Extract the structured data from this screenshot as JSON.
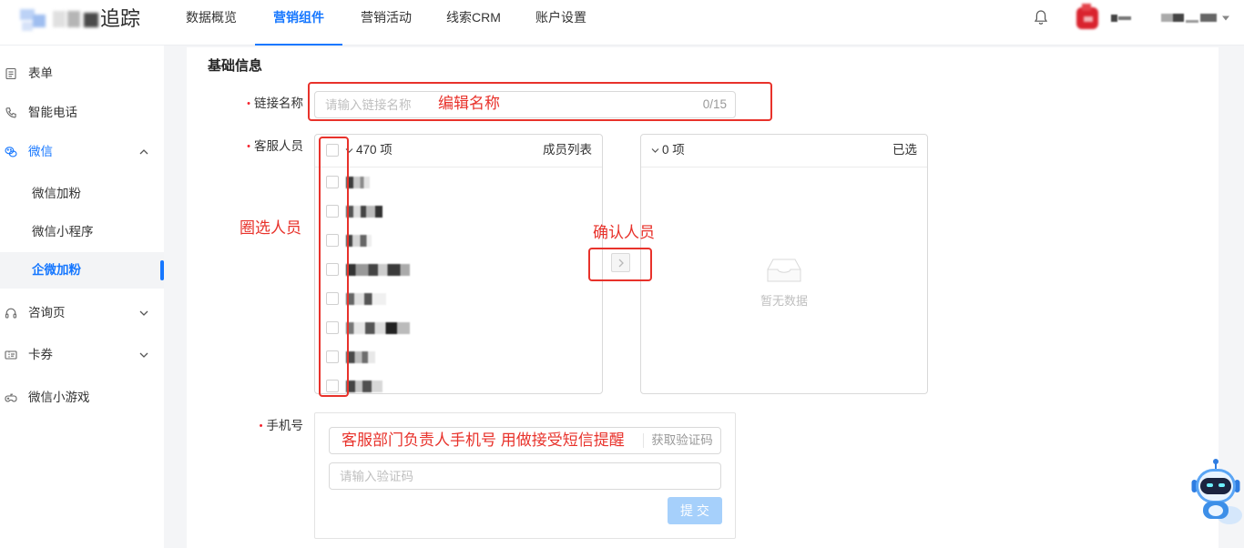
{
  "header": {
    "logo_text": "追踪",
    "nav": [
      {
        "label": "数据概览",
        "active": false
      },
      {
        "label": "营销组件",
        "active": true
      },
      {
        "label": "营销活动",
        "active": false
      },
      {
        "label": "线索CRM",
        "active": false
      },
      {
        "label": "账户设置",
        "active": false
      }
    ],
    "icons": {
      "notification": "bell-icon",
      "user_menu": "caret-down-icon"
    }
  },
  "sidebar": {
    "items": [
      {
        "label": "表单",
        "icon": "form-icon"
      },
      {
        "label": "智能电话",
        "icon": "phone-icon"
      },
      {
        "label": "微信",
        "icon": "wechat-icon",
        "expanded": true,
        "children": [
          {
            "label": "微信加粉",
            "active": false
          },
          {
            "label": "微信小程序",
            "active": false
          },
          {
            "label": "企微加粉",
            "active": true
          }
        ]
      },
      {
        "label": "咨询页",
        "icon": "headset-icon",
        "expanded": false
      },
      {
        "label": "卡券",
        "icon": "coupon-icon",
        "expanded": false
      },
      {
        "label": "微信小游戏",
        "icon": "gamepad-icon"
      }
    ]
  },
  "form": {
    "section_title": "基础信息",
    "required_mark": "•",
    "link_name": {
      "label": "链接名称",
      "placeholder": "请输入链接名称",
      "counter": "0/15"
    },
    "staff": {
      "label": "客服人员",
      "source": {
        "count": "470 项",
        "title": "成员列表",
        "items": [
          {
            "checked": false,
            "name_redacted": true
          },
          {
            "checked": false,
            "name_redacted": true
          },
          {
            "checked": false,
            "name_redacted": true
          },
          {
            "checked": false,
            "name_redacted": true
          },
          {
            "checked": false,
            "name_redacted": true
          },
          {
            "checked": false,
            "name_redacted": true
          },
          {
            "checked": false,
            "name_redacted": true
          },
          {
            "checked": false,
            "name_redacted": true
          }
        ]
      },
      "transfer_icon": "chevron-right-icon",
      "target": {
        "count": "0 项",
        "title": "已选",
        "empty_text": "暂无数据",
        "empty_icon": "inbox-icon"
      }
    },
    "phone": {
      "label": "手机号",
      "get_code_label": "获取验证码",
      "code_placeholder": "请输入验证码",
      "submit_label": "提 交"
    }
  },
  "annotations": {
    "edit_name": "编辑名称",
    "select_staff": "圈选人员",
    "confirm_staff": "确认人员",
    "phone_note": "客服部门负责人手机号 用做接受短信提醒"
  },
  "assistant_icon": "robot-assistant-icon",
  "colors": {
    "primary": "#1677ff",
    "annotation": "#e8322b",
    "required": "#f5222d",
    "submit_disabled": "#a6d0fb",
    "page_background": "#f4f5f7"
  }
}
